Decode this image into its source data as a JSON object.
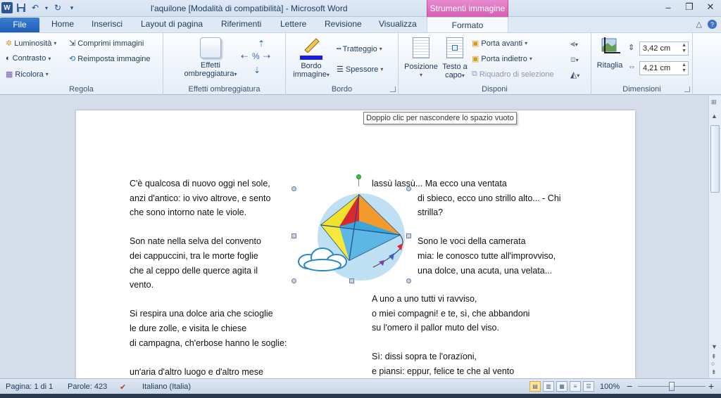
{
  "titlebar": {
    "title": "l'aquilone [Modalità di compatibilità]  -  Microsoft Word",
    "context_tab_header": "Strumenti immagine",
    "app_icon": "W"
  },
  "tabs": {
    "file": "File",
    "items": [
      "Home",
      "Inserisci",
      "Layout di pagina",
      "Riferimenti",
      "Lettere",
      "Revisione",
      "Visualizza"
    ],
    "active": "Formato"
  },
  "ribbon": {
    "regola": {
      "label": "Regola",
      "luminosita": "Luminosità",
      "contrasto": "Contrasto",
      "ricolora": "Ricolora",
      "comprimi": "Comprimi immagini",
      "reimposta": "Reimposta immagine"
    },
    "effetti": {
      "label": "Effetti ombreggiatura",
      "button_line1": "Effetti",
      "button_line2": "ombreggiatura"
    },
    "bordo": {
      "label": "Bordo",
      "bordo_line1": "Bordo",
      "bordo_line2": "immagine",
      "tratteggio": "Tratteggio",
      "spessore": "Spessore"
    },
    "disponi": {
      "label": "Disponi",
      "posizione": "Posizione",
      "testo_line1": "Testo a",
      "testo_line2": "capo",
      "porta_avanti": "Porta avanti",
      "porta_indietro": "Porta indietro",
      "riquadro": "Riquadro di selezione"
    },
    "dimensioni": {
      "label": "Dimensioni",
      "ritaglia": "Ritaglia",
      "height": "3,42 cm",
      "width": "4,21 cm"
    }
  },
  "tooltip": "Doppio clic per nascondere lo spazio vuoto",
  "document": {
    "left_col": [
      "C'è qualcosa di nuovo oggi nel sole,",
      "anzi d'antico: io vivo altrove, e sento",
      "che sono intorno nate le viole.",
      "",
      "Son nate nella selva del convento",
      "dei cappuccini, tra le morte foglie",
      "che al ceppo delle querce agita il",
      "vento.",
      "",
      "Si respira una dolce aria che scioglie",
      "le dure zolle, e visita le chiese",
      "di campagna, ch'erbose hanno le soglie:",
      "",
      "un'aria d'altro luogo e d'altro mese"
    ],
    "right_col_top": [
      "lassù lassù... Ma ecco una ventata",
      "di sbieco, ecco uno strillo alto... - Chi",
      "strilla?",
      "",
      "Sono le voci della camerata",
      "mia: le conosco tutte all'improvviso,",
      "una dolce, una acuta, una velata..."
    ],
    "right_col_bottom": [
      "A uno a uno tutti vi ravviso,",
      "o miei compagni! e te, sì, che abbandoni",
      "su l'omero il pallor muto del viso.",
      "",
      "Sì: dissi sopra te l'orazïoni,",
      "e piansi: eppur, felice te che al vento"
    ]
  },
  "statusbar": {
    "page": "Pagina: 1 di 1",
    "words": "Parole: 423",
    "language": "Italiano (Italia)",
    "zoom": "100%",
    "zoom_minus": "−",
    "zoom_plus": "+"
  },
  "colors": {
    "file_tab": "#2a66c0",
    "context_tab": "#d45fb4",
    "border_color_swatch": "#1a1ae6"
  }
}
